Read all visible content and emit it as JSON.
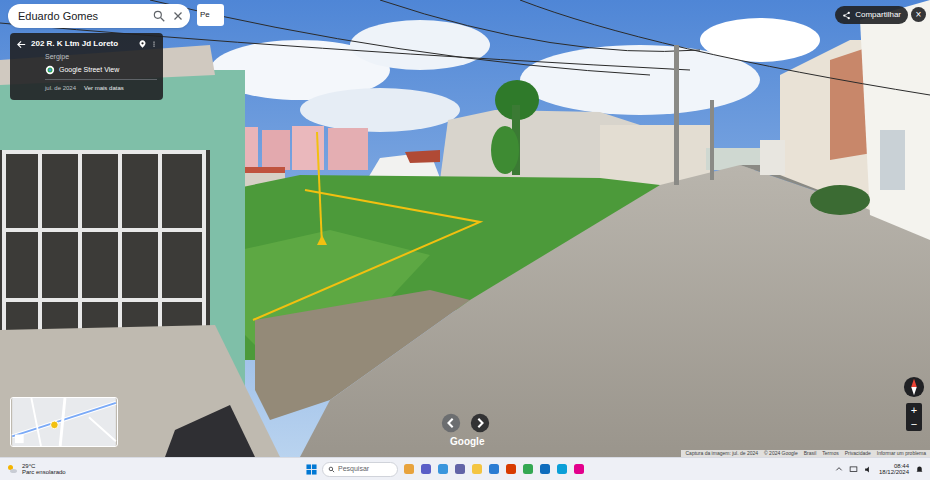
{
  "search": {
    "value": "Eduardo Gomes",
    "next_field": "Pe"
  },
  "info_card": {
    "address": "202 R. K Ltm Jd Loreto",
    "region": "Sergipe",
    "source": "Google Street View",
    "date": "jul. de 2024",
    "more_dates": "Ver mais datas"
  },
  "share": {
    "label": "Compartilhar",
    "close": "×"
  },
  "google_logo": "Google",
  "zoom": [
    "+",
    "−"
  ],
  "attribution": [
    "Captura da imagem: jul. de 2024",
    "© 2024 Google",
    "Brasil",
    "Termos",
    "Privacidade",
    "Informar um problema"
  ],
  "taskbar": {
    "temperature": "29°C",
    "weather": "Parc ensolarado",
    "search": "Pesquisar",
    "time": "08:44",
    "date": "18/12/2024"
  }
}
